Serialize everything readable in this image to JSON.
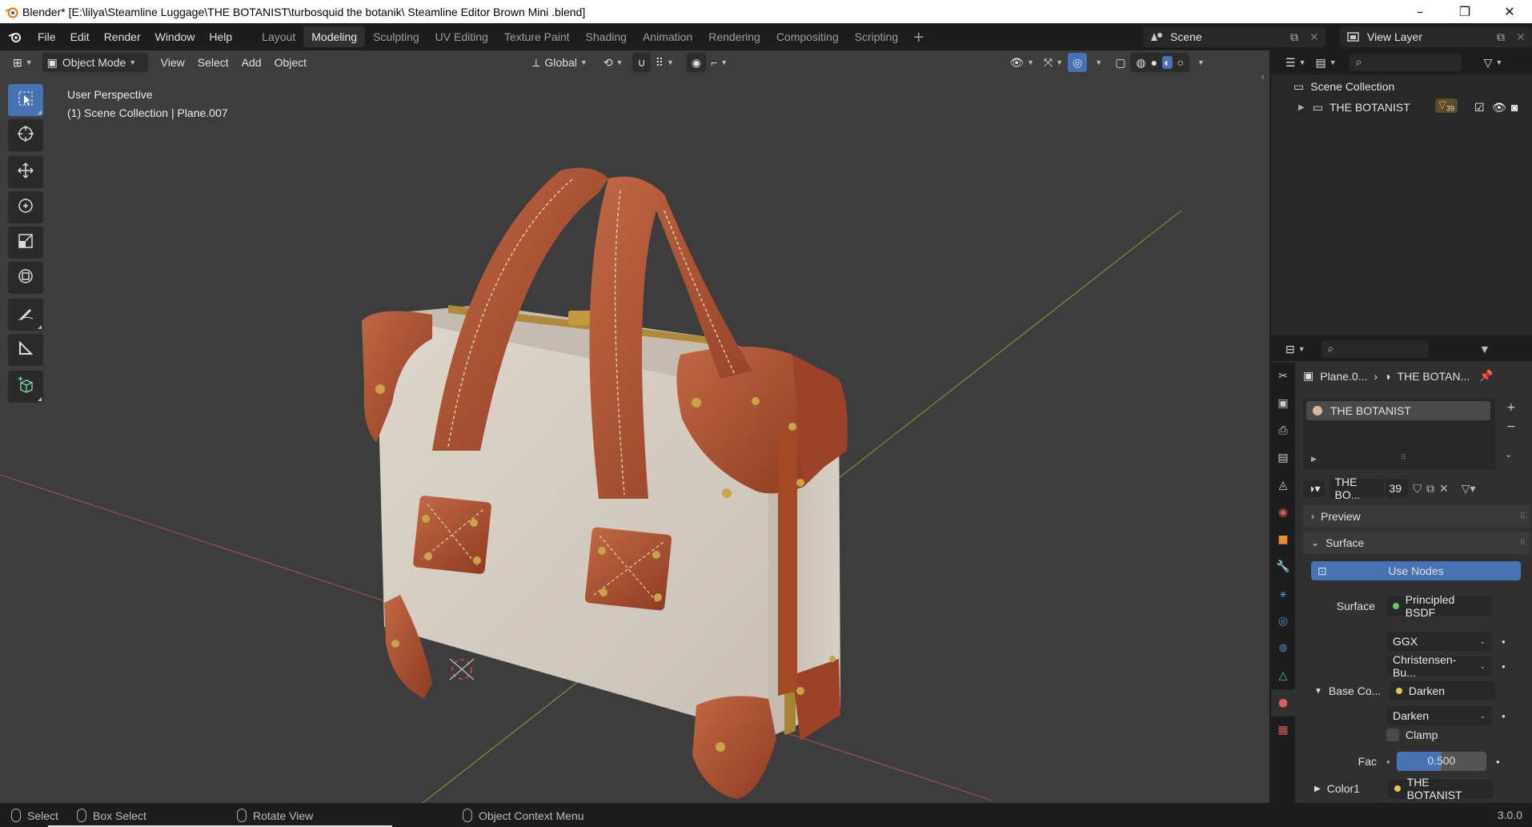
{
  "window": {
    "title": "Blender* [E:\\lilya\\Steamline Luggage\\THE BOTANIST\\turbosquid the botanik\\ Steamline Editor Brown Mini .blend]",
    "minimize": "–",
    "restore": "❐",
    "close": "✕"
  },
  "menu": {
    "items": [
      "File",
      "Edit",
      "Render",
      "Window",
      "Help"
    ]
  },
  "workspaces": {
    "tabs": [
      "Layout",
      "Modeling",
      "Sculpting",
      "UV Editing",
      "Texture Paint",
      "Shading",
      "Animation",
      "Rendering",
      "Compositing",
      "Scripting"
    ],
    "active": "Modeling"
  },
  "scene": {
    "name": "Scene"
  },
  "view_layer": {
    "name": "View Layer"
  },
  "viewport": {
    "mode": "Object Mode",
    "menus": [
      "View",
      "Select",
      "Add",
      "Object"
    ],
    "orientation": "Global",
    "perspective": "User Perspective",
    "collection_info": "(1) Scene Collection | Plane.007"
  },
  "outliner": {
    "root": "Scene Collection",
    "items": [
      {
        "label": "THE BOTANIST",
        "badge": "39"
      }
    ]
  },
  "properties": {
    "breadcrumb_object": "Plane.0...",
    "breadcrumb_material": "THE BOTAN...",
    "material_slot": "THE BOTANIST",
    "material_name": "THE BO...",
    "users": "39",
    "sections": {
      "preview": "Preview",
      "surface": "Surface"
    },
    "use_nodes": "Use Nodes",
    "surface_label": "Surface",
    "surface_value": "Principled BSDF",
    "distribution": "GGX",
    "subsurface": "Christensen-Bu...",
    "base_color_label": "Base Co...",
    "base_color_value": "Darken",
    "blend_mode": "Darken",
    "clamp_label": "Clamp",
    "fac_label": "Fac",
    "fac_value": "0.500",
    "fac_fraction": 0.5,
    "color1_label": "Color1",
    "color1_value": "THE BOTANIST"
  },
  "statusbar": {
    "select": "Select",
    "box_select": "Box Select",
    "rotate_view": "Rotate View",
    "context_menu": "Object Context Menu",
    "version": "3.0.0"
  },
  "colors": {
    "accent_blue": "#4772b3",
    "leather": "#a5482a",
    "canvas": "#d8d0c4",
    "viewport_bg": "#3d3d3d"
  }
}
